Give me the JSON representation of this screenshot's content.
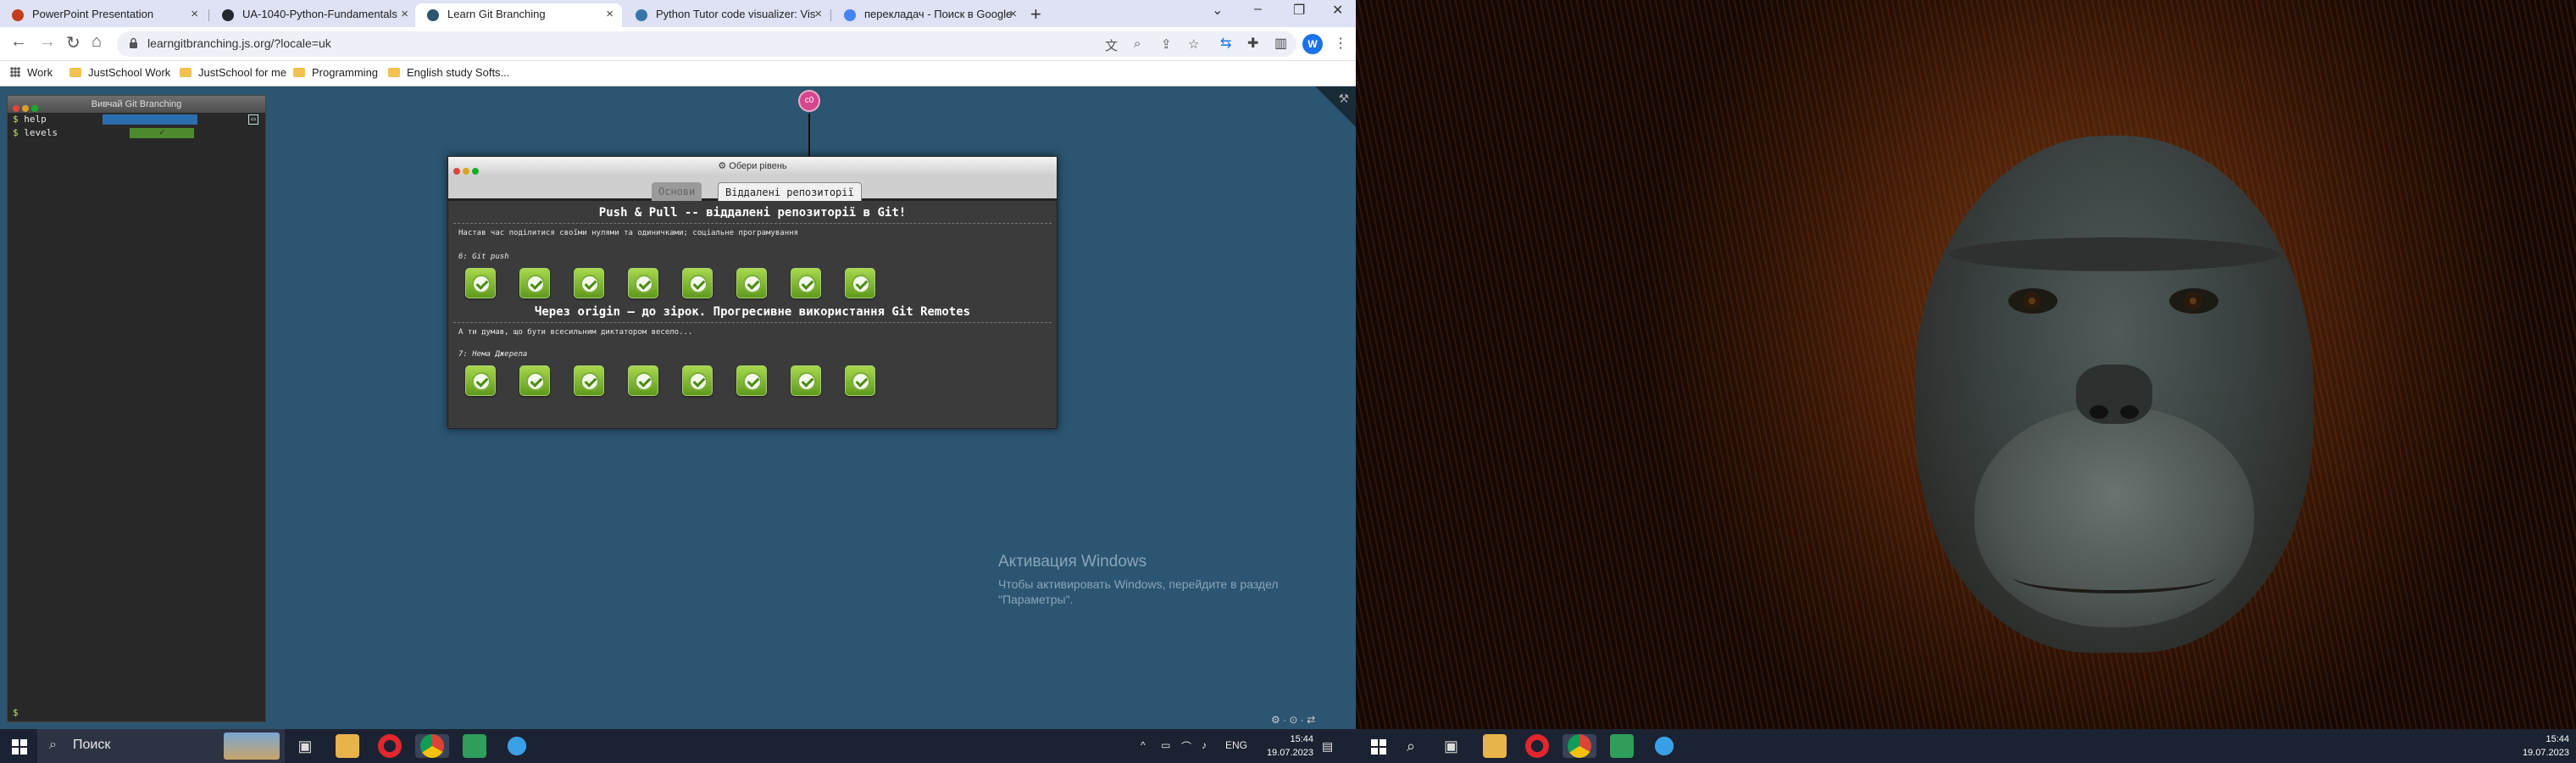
{
  "browser": {
    "tabs": [
      {
        "title": "PowerPoint Presentation",
        "favicon_color": "#c43e1c"
      },
      {
        "title": "UA-1040-Python-Fundamentals",
        "favicon_color": "#24292f"
      },
      {
        "title": "Learn Git Branching",
        "favicon_color": "#2b5571",
        "active": true
      },
      {
        "title": "Python Tutor code visualizer: Vis",
        "favicon_color": "#3776ab"
      },
      {
        "title": "перекладач - Поиск в Google",
        "favicon_color": "#4285f4"
      }
    ],
    "new_tab_label": "+",
    "url": "learngitbranching.js.org/?locale=uk",
    "profile_initial": "W",
    "bookmarks": [
      "Work",
      "JustSchool Work",
      "JustSchool for me",
      "Programming",
      "English study Softs..."
    ]
  },
  "terminal": {
    "title": "Вивчай Git Branching",
    "lines": [
      {
        "cmd": "help"
      },
      {
        "cmd": "levels",
        "badge": "✓"
      }
    ],
    "prompt": "$"
  },
  "commit": {
    "label": "c0"
  },
  "dialog": {
    "title": "⚙ Обери рівень",
    "tabs": {
      "inactive": "Основи",
      "active": "Віддалені репозиторії"
    },
    "sections": [
      {
        "title": "Push & Pull -- віддалені репозиторії в Git!",
        "description": "Настав час поділитися своїми нулями та одиничками; соціальне програмування",
        "level_name": "6: Git push",
        "levels_completed": 8
      },
      {
        "title": "Через origin – до зірок. Прогресивне використання Git Remotes",
        "description": "А ти думав, що бути всесильним диктатором весело...",
        "level_name": "7: Нема Джерела",
        "levels_completed": 8
      }
    ]
  },
  "activation": {
    "title": "Активация Windows",
    "subtitle": "Чтобы активировать Windows, перейдите в раздел \"Параметры\"."
  },
  "taskbar": {
    "search_placeholder": "Поиск",
    "language": "ENG",
    "time": "15:44",
    "date": "19.07.2023"
  },
  "taskbar_right": {
    "time": "15:44",
    "date": "19.07.2023"
  }
}
